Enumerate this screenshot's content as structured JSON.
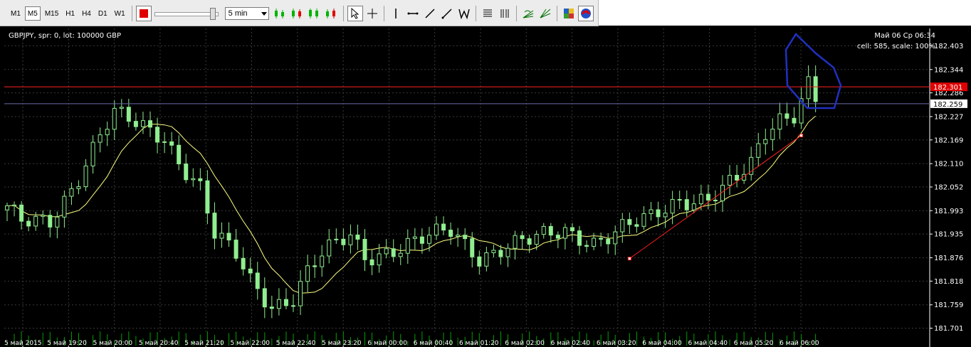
{
  "toolbar": {
    "timeframes": [
      "M1",
      "M5",
      "M15",
      "H1",
      "H4",
      "D1",
      "W1"
    ],
    "active_timeframe": "M5",
    "speed_select": "5 min",
    "colors": {
      "green": "#00b400",
      "red": "#e00000",
      "blue": "#2050c8"
    }
  },
  "chart": {
    "info_left": "GBPJPY, spr: 0, lot: 100000 GBP",
    "info_right_1": "Май 06 Ср 06:34",
    "info_right_2": "cell: 585, scale: 100%",
    "red_price_label": "182.301",
    "white_price_label": "182.259",
    "colors": {
      "background": "#000000",
      "candle": "#90ee90",
      "ma": "#ffff80",
      "grid": "#3a3a3a",
      "red_line": "#ff2020",
      "volume": "#00a000"
    }
  },
  "chart_data": {
    "type": "candlestick",
    "symbol": "GBPJPY",
    "price_ticks": [
      "182.403",
      "182.344",
      "182.286",
      "182.227",
      "182.169",
      "182.110",
      "182.052",
      "181.993",
      "181.935",
      "181.876",
      "181.818",
      "181.759",
      "181.701"
    ],
    "time_ticks": [
      "5 май 2015",
      "5 май 19:20",
      "5 май 20:00",
      "5 май 20:40",
      "5 май 21:20",
      "5 май 22:00",
      "5 май 22:40",
      "5 май 23:20",
      "6 май 00:00",
      "6 май 00:40",
      "6 май 01:20",
      "6 май 02:00",
      "6 май 02:40",
      "6 май 03:20",
      "6 май 04:00",
      "6 май 04:40",
      "6 май 05:20",
      "6 май 06:00"
    ],
    "ylim": [
      181.686,
      182.432
    ],
    "red_horizontal_level": 182.301,
    "blue_horizontal_level": 182.259,
    "anchors": [
      [
        0,
        181.995
      ],
      [
        2,
        181.96
      ],
      [
        6,
        181.97
      ],
      [
        10,
        182.08
      ],
      [
        13,
        182.18
      ],
      [
        15,
        182.23
      ],
      [
        19,
        182.2
      ],
      [
        22,
        182.18
      ],
      [
        24,
        182.12
      ],
      [
        27,
        182.05
      ],
      [
        29,
        181.93
      ],
      [
        32,
        181.88
      ],
      [
        34,
        181.82
      ],
      [
        37,
        181.76
      ],
      [
        40,
        181.78
      ],
      [
        42,
        181.84
      ],
      [
        44,
        181.88
      ],
      [
        48,
        181.93
      ],
      [
        50,
        181.88
      ],
      [
        54,
        181.9
      ],
      [
        58,
        181.92
      ],
      [
        62,
        181.94
      ],
      [
        66,
        181.88
      ],
      [
        70,
        181.91
      ],
      [
        74,
        181.92
      ],
      [
        78,
        181.94
      ],
      [
        82,
        181.92
      ],
      [
        86,
        181.95
      ],
      [
        90,
        181.97
      ],
      [
        94,
        182.02
      ],
      [
        98,
        182.03
      ],
      [
        102,
        182.07
      ],
      [
        104,
        182.1
      ],
      [
        106,
        182.18
      ],
      [
        108,
        182.22
      ],
      [
        110,
        182.24
      ],
      [
        112,
        182.32
      ],
      [
        113,
        182.28
      ]
    ],
    "trendline": {
      "start": {
        "index": 87,
        "price": 181.874
      },
      "end": {
        "index": 111,
        "price": 182.18
      }
    }
  }
}
